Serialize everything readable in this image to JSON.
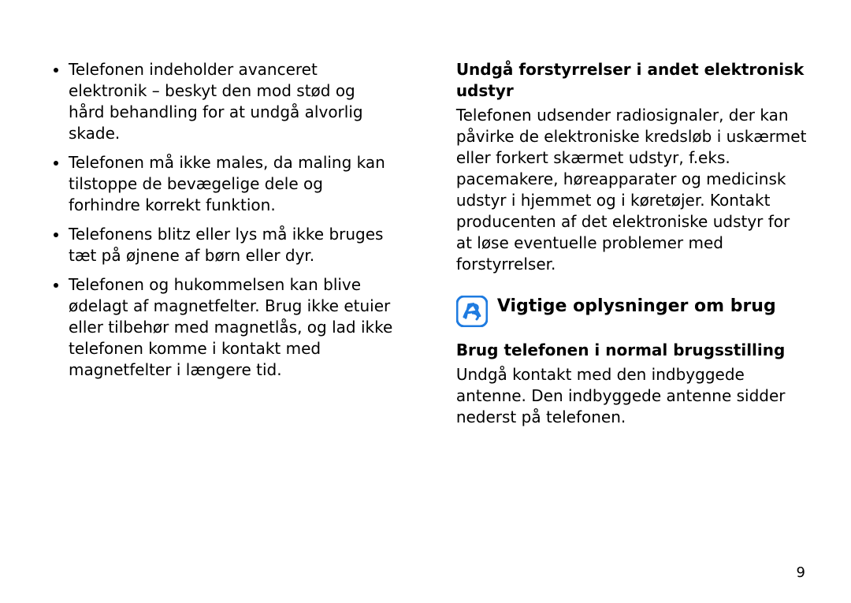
{
  "left": {
    "bullets": [
      "Telefonen indeholder avanceret elektronik – beskyt den mod stød og hård behandling for at undgå alvorlig skade.",
      "Telefonen må ikke males, da maling kan tilstoppe de bevægelige dele og forhindre korrekt funktion.",
      "Telefonens blitz eller lys må ikke bruges tæt på øjnene af børn eller dyr.",
      "Telefonen og hukommelsen kan blive ødelagt af magnetfelter. Brug ikke etuier eller tilbehør med magnetlås, og lad ikke telefonen komme i kontakt med magnetfelter i længere tid."
    ]
  },
  "right": {
    "sub1_head": "Undgå forstyrrelser i andet elektronisk udstyr",
    "sub1_body": "Telefonen udsender radiosignaler, der kan påvirke de elektroniske kredsløb i uskærmet eller forkert skærmet udstyr, f.eks. pacemakere, høreapparater og medicinsk udstyr i hjemmet og i køretøjer. Kontakt producenten af det elektroniske udstyr for at løse eventuelle problemer med forstyrrelser.",
    "section_title": "Vigtige oplysninger om brug",
    "sub2_head": "Brug telefonen i normal brugsstilling",
    "sub2_body": "Undgå kontakt med den indbyggede antenne. Den indbyggede antenne sidder nederst på telefonen."
  },
  "page_number": "9",
  "icon_color": "#1e7be0"
}
